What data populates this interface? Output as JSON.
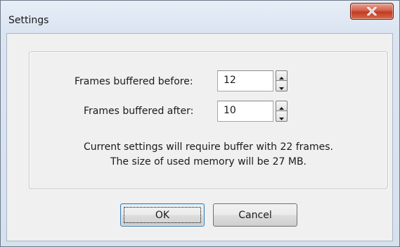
{
  "window": {
    "title": "Settings"
  },
  "titlebar": {
    "close_icon": "close-icon"
  },
  "frames_before": {
    "label": "Frames buffered before:",
    "value": "12"
  },
  "frames_after": {
    "label": "Frames buffered after:",
    "value": "10"
  },
  "info": {
    "line1": "Current settings will require buffer with 22 frames.",
    "line2": "The size of used memory will be 27 MB."
  },
  "buttons": {
    "ok_label": "OK",
    "cancel_label": "Cancel"
  },
  "colors": {
    "close_button": "#c23b22",
    "dialog_background": "#f0f0f0",
    "frame": "#d6e1ee"
  }
}
